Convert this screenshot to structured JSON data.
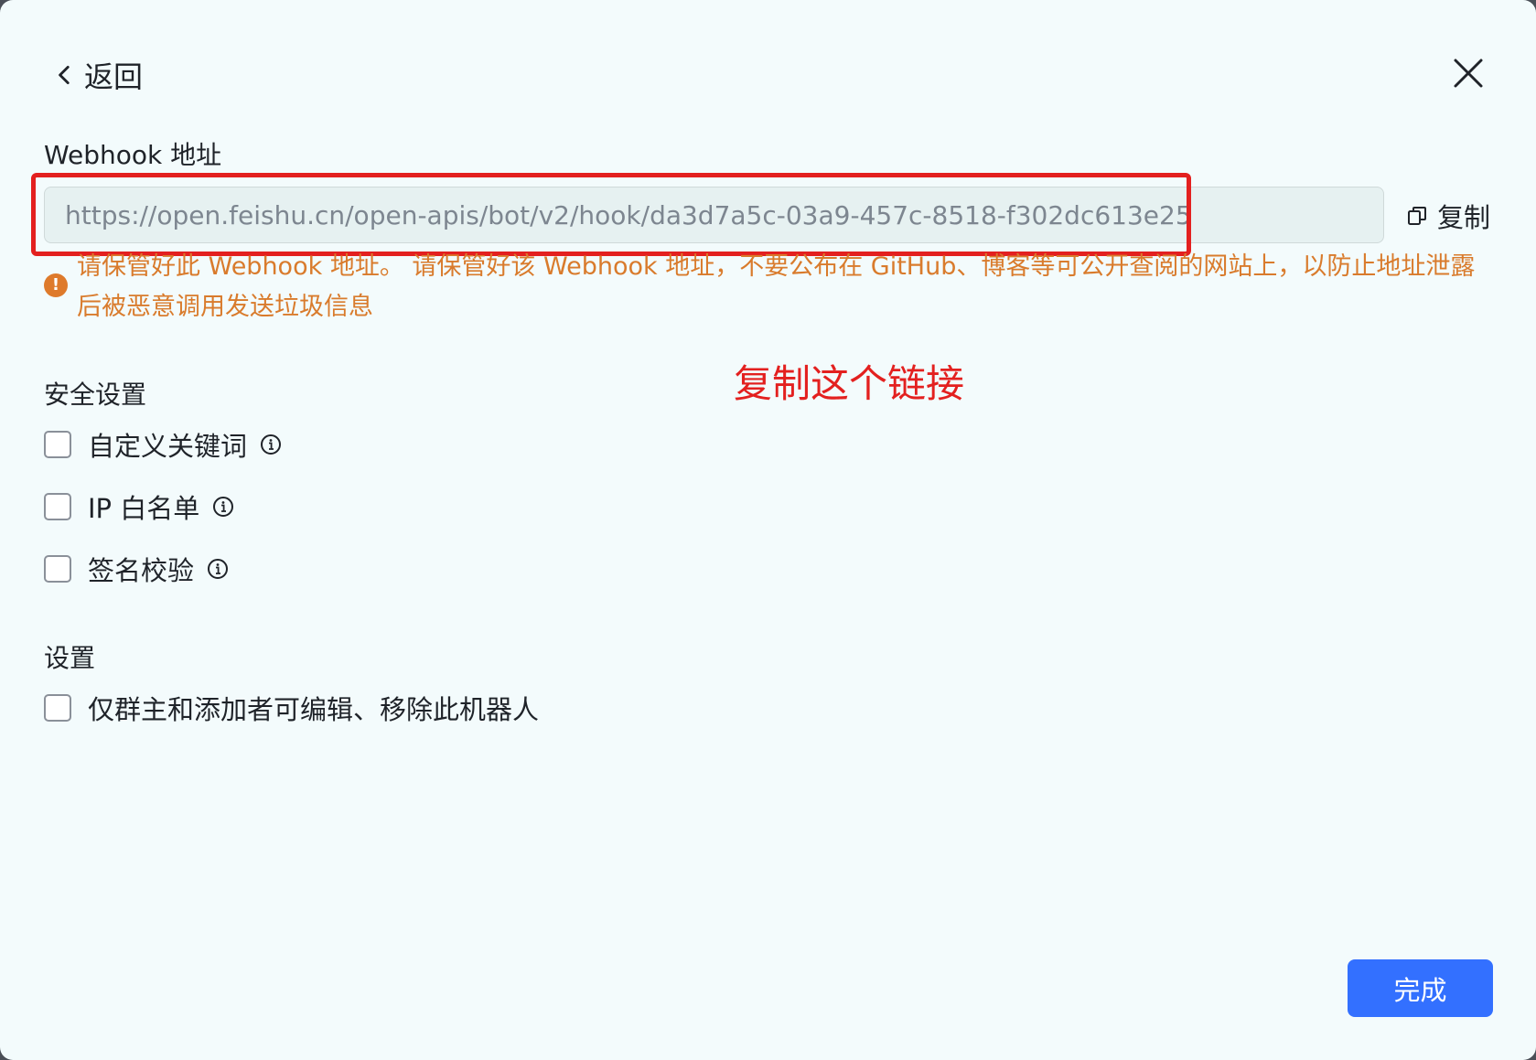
{
  "header": {
    "back_label": "返回"
  },
  "webhook": {
    "label": "Webhook 地址",
    "url": "https://open.feishu.cn/open-apis/bot/v2/hook/da3d7a5c-03a9-457c-8518-f302dc613e25",
    "copy_label": "复制",
    "warning": "请保管好此 Webhook 地址。 请保管好该 Webhook 地址，不要公布在 GitHub、博客等可公开查阅的网站上，以防止地址泄露后被恶意调用发送垃圾信息"
  },
  "annotation": {
    "text": "复制这个链接",
    "color": "#e3201f"
  },
  "security": {
    "title": "安全设置",
    "options": [
      {
        "label": "自定义关键词",
        "checked": false
      },
      {
        "label": "IP 白名单",
        "checked": false
      },
      {
        "label": "签名校验",
        "checked": false
      }
    ]
  },
  "settings": {
    "title": "设置",
    "options": [
      {
        "label": "仅群主和添加者可编辑、移除此机器人",
        "checked": false
      }
    ]
  },
  "footer": {
    "done_label": "完成"
  },
  "colors": {
    "primary": "#3370ff",
    "warning": "#d97b2c",
    "background": "#f3fbfc"
  }
}
